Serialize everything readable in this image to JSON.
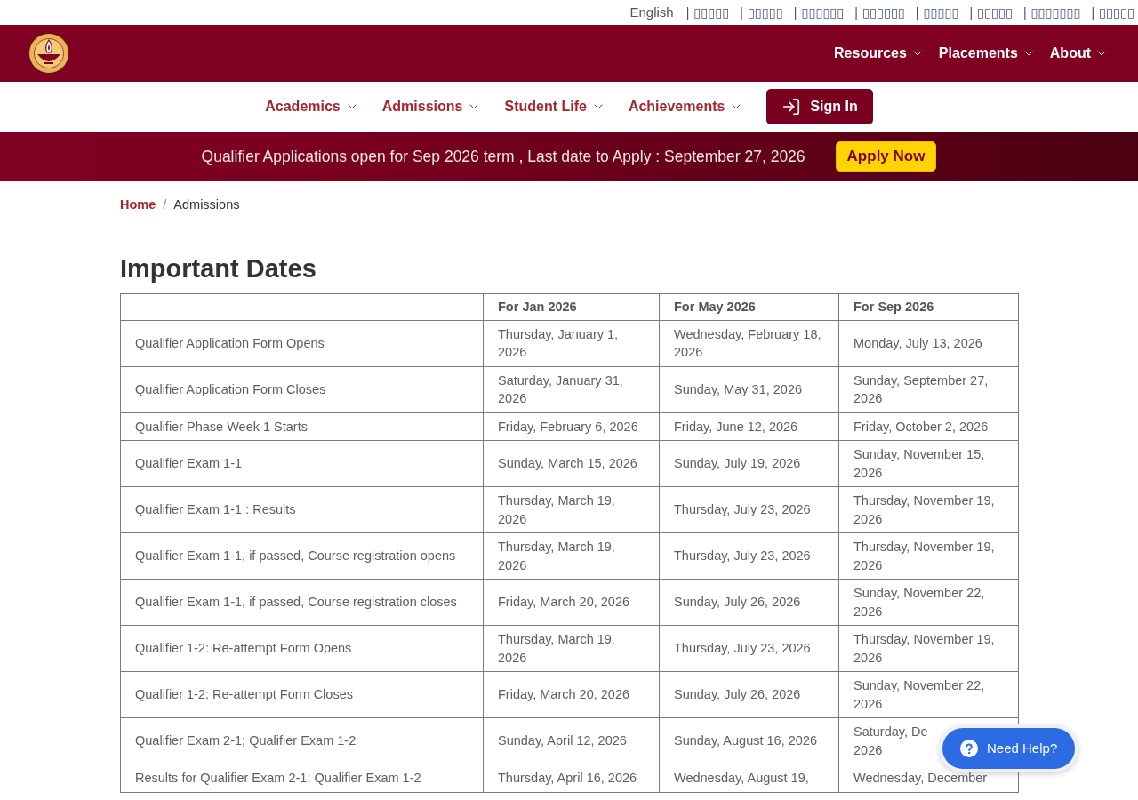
{
  "language_bar": {
    "items": [
      {
        "label": "English"
      },
      {
        "separator": "|",
        "label": "▯▯▯▯▯"
      },
      {
        "separator": "|",
        "label": "▯▯▯▯▯"
      },
      {
        "separator": "|",
        "label": "▯▯▯▯▯▯"
      },
      {
        "separator": "|",
        "label": "▯▯▯▯▯▯"
      },
      {
        "separator": "|",
        "label": "▯▯▯▯▯"
      },
      {
        "separator": "|",
        "label": "▯▯▯▯▯"
      },
      {
        "separator": "|",
        "label": "▯▯▯▯▯▯▯"
      },
      {
        "separator": "|",
        "label": "▯▯▯▯▯"
      }
    ]
  },
  "header": {
    "nav": [
      {
        "label": "Resources",
        "dropdown": true
      },
      {
        "label": "Placements",
        "dropdown": true
      },
      {
        "label": "About",
        "dropdown": true
      }
    ]
  },
  "subnav": {
    "items": [
      {
        "label": "Academics",
        "dropdown": true
      },
      {
        "label": "Admissions",
        "dropdown": true
      },
      {
        "label": "Student Life",
        "dropdown": true
      },
      {
        "label": "Achievements",
        "dropdown": true
      }
    ],
    "sign_in": "Sign In"
  },
  "banner": {
    "text": "Qualifier Applications open for Sep 2026 term , Last date to Apply : September 27, 2026",
    "button": "Apply Now"
  },
  "breadcrumb": {
    "separator": "/",
    "items": [
      {
        "label": "Home",
        "current": false
      },
      {
        "label": "Admissions",
        "current": true
      }
    ]
  },
  "page_title": "Important Dates",
  "table": {
    "columns": [
      "For Jan 2026",
      "For May 2026",
      "For Sep 2026"
    ],
    "rows": [
      {
        "event": "Qualifier Application Form Opens",
        "dates": [
          "Thursday, January 1, 2026",
          "Wednesday, February 18, 2026",
          "Monday, July 13, 2026"
        ]
      },
      {
        "event": "Qualifier Application Form Closes",
        "dates": [
          "Saturday, January 31, 2026",
          "Sunday, May 31, 2026",
          "Sunday, September 27, 2026"
        ]
      },
      {
        "event": "Qualifier Phase Week 1 Starts",
        "dates": [
          "Friday, February 6, 2026",
          "Friday, June 12, 2026",
          "Friday, October 2, 2026"
        ]
      },
      {
        "event": "Qualifier Exam 1-1",
        "dates": [
          "Sunday, March 15, 2026",
          "Sunday, July 19, 2026",
          "Sunday, November 15, 2026"
        ]
      },
      {
        "event": "Qualifier Exam 1-1 : Results",
        "dates": [
          "Thursday, March 19, 2026",
          "Thursday, July 23, 2026",
          "Thursday, November 19, 2026"
        ]
      },
      {
        "event": "Qualifier Exam 1-1, if passed, Course registration opens",
        "dates": [
          "Thursday, March 19, 2026",
          "Thursday, July 23, 2026",
          "Thursday, November 19, 2026"
        ]
      },
      {
        "event": "Qualifier Exam 1-1, if passed, Course registration closes",
        "dates": [
          "Friday, March 20, 2026",
          "Sunday, July 26, 2026",
          "Sunday, November 22, 2026"
        ]
      },
      {
        "event": "Qualifier 1-2: Re-attempt Form Opens",
        "dates": [
          "Thursday, March 19, 2026",
          "Thursday, July 23, 2026",
          "Thursday, November 19, 2026"
        ]
      },
      {
        "event": "Qualifier 1-2: Re-attempt Form Closes",
        "dates": [
          "Friday, March 20, 2026",
          "Sunday, July 26, 2026",
          "Sunday, November 22, 2026"
        ]
      },
      {
        "event": "Qualifier Exam 2-1; Qualifier Exam 1-2",
        "dates": [
          "Sunday, April 12, 2026",
          "Sunday, August 16, 2026",
          "Saturday, De\n2026"
        ]
      },
      {
        "event": "Results for Qualifier Exam 2-1; Qualifier Exam 1-2",
        "dates": [
          "Thursday, April 16, 2026",
          "Wednesday, August 19,",
          "Wednesday, December"
        ]
      }
    ]
  },
  "help_button": {
    "label": "Need Help?"
  }
}
